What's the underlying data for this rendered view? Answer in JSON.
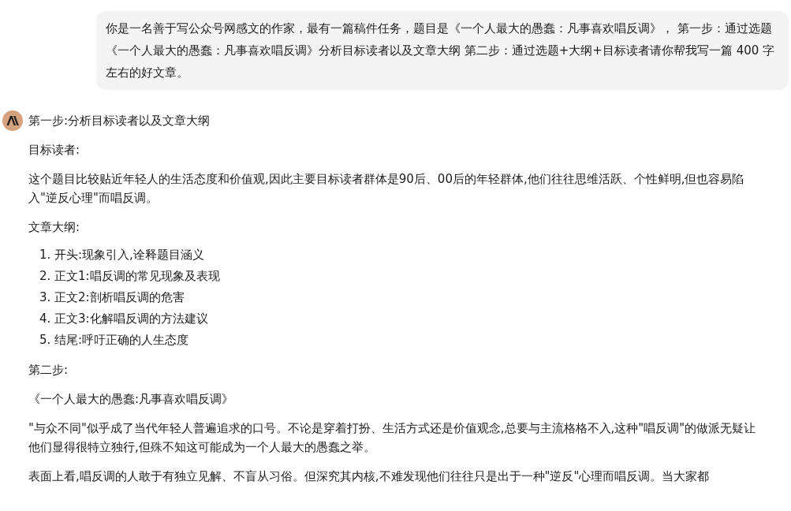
{
  "user_message": {
    "text": "你是一名善于写公众号网感文的作家，最有一篇稿件任务，题目是《一个人最大的愚蠢：凡事喜欢唱反调》， 第一步：通过选题《一个人最大的愚蠢：凡事喜欢唱反调》分析目标读者以及文章大纲 第二步：通过选题+大纲+目标读者请你帮我写一篇 400 字左右的好文章。"
  },
  "response": {
    "blocks": [
      {
        "kind": "paragraph",
        "text": "第一步:分析目标读者以及文章大纲"
      },
      {
        "kind": "paragraph",
        "text": "目标读者:"
      },
      {
        "kind": "paragraph",
        "text": "这个题目比较贴近年轻人的生活态度和价值观,因此主要目标读者群体是90后、00后的年轻群体,他们往往思维活跃、个性鲜明,但也容易陷入\"逆反心理\"而唱反调。"
      },
      {
        "kind": "paragraph",
        "text": "文章大纲:"
      },
      {
        "kind": "list",
        "items": [
          {
            "number": "1.",
            "text": "开头:现象引入,诠释题目涵义"
          },
          {
            "number": "2.",
            "text": "正文1:唱反调的常见现象及表现"
          },
          {
            "number": "3.",
            "text": "正文2:剖析唱反调的危害"
          },
          {
            "number": "4.",
            "text": "正文3:化解唱反调的方法建议"
          },
          {
            "number": "5.",
            "text": "结尾:呼吁正确的人生态度"
          }
        ]
      },
      {
        "kind": "paragraph",
        "text": "第二步:"
      },
      {
        "kind": "paragraph",
        "text": "《一个人最大的愚蠢:凡事喜欢唱反调》"
      },
      {
        "kind": "paragraph",
        "text": "\"与众不同\"似乎成了当代年轻人普遍追求的口号。不论是穿着打扮、生活方式还是价值观念,总要与主流格格不入,这种\"唱反调\"的做派无疑让他们显得很特立独行,但殊不知这可能成为一个人最大的愚蠢之举。"
      },
      {
        "kind": "paragraph",
        "text": "表面上看,唱反调的人敢于有独立见解、不盲从习俗。但深究其内核,不难发现他们往往只是出于一种\"逆反\"心理而唱反调。当大家都"
      }
    ]
  }
}
